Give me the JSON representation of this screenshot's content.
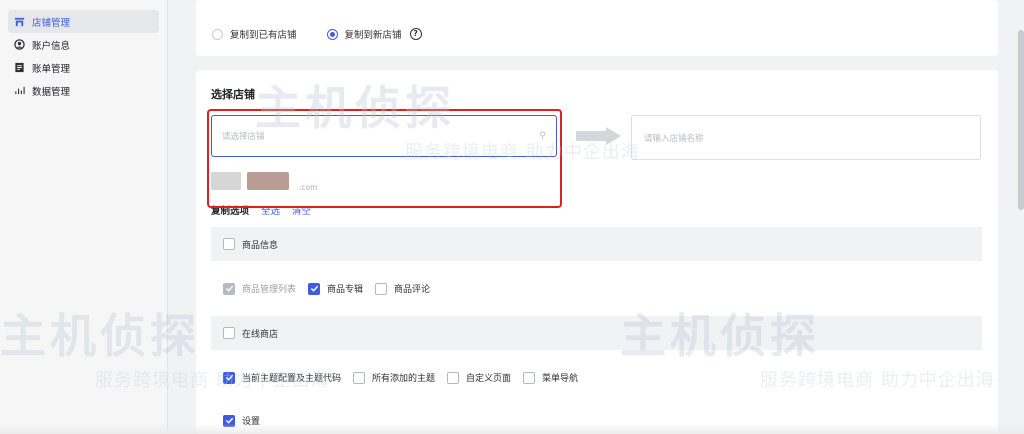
{
  "sidebar": {
    "items": [
      {
        "label": "店铺管理",
        "icon": "store-icon",
        "active": true
      },
      {
        "label": "账户信息",
        "icon": "account-icon",
        "active": false
      },
      {
        "label": "账单管理",
        "icon": "bill-icon",
        "active": false
      },
      {
        "label": "数据管理",
        "icon": "chart-icon",
        "active": false
      }
    ]
  },
  "copy_mode": {
    "options": [
      {
        "label": "复制到已有店铺",
        "selected": false
      },
      {
        "label": "复制到新店铺",
        "selected": true
      }
    ],
    "help_icon": "help-circle-icon"
  },
  "select_store": {
    "title": "选择店铺",
    "placeholder": "请选择店铺",
    "name_placeholder": "请输入店铺名称",
    "dropdown_domain": ".com"
  },
  "copy_options": {
    "label": "复制选项",
    "select_all": "全选",
    "clear": "清空"
  },
  "groups": [
    {
      "header": "商品信息",
      "items": [
        {
          "label": "商品管理列表",
          "checked": true,
          "disabled": true
        },
        {
          "label": "商品专辑",
          "checked": true,
          "disabled": false
        },
        {
          "label": "商品评论",
          "checked": false,
          "disabled": false
        }
      ]
    },
    {
      "header": "在线商店",
      "items": [
        {
          "label": "当前主题配置及主题代码",
          "checked": true,
          "disabled": false
        },
        {
          "label": "所有添加的主题",
          "checked": false,
          "disabled": false
        },
        {
          "label": "自定义页面",
          "checked": false,
          "disabled": false
        },
        {
          "label": "菜单导航",
          "checked": false,
          "disabled": false
        }
      ]
    }
  ],
  "settings_label": "设置",
  "watermark": {
    "brand": "主机侦探",
    "slogan": "服务跨境电商 助力中企出海"
  },
  "colors": {
    "accent": "#3d5ce0",
    "highlight": "#e02020"
  }
}
